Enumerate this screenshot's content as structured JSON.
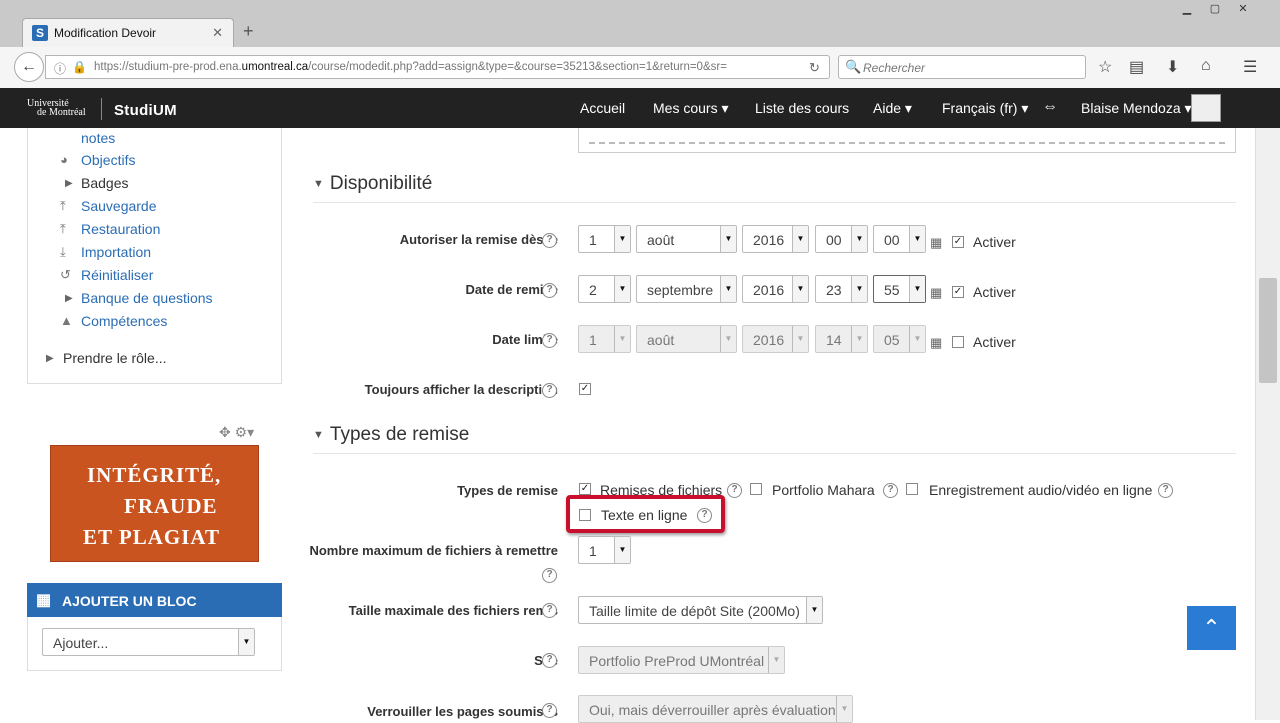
{
  "browser": {
    "tab_title": "Modification Devoir",
    "tab_favicon": "S",
    "url_prefix": "https://studium-pre-prod.ena.",
    "url_domain": "umontreal.ca",
    "url_path": "/course/modedit.php?add=assign&type=&course=35213&section=1&return=0&sr=",
    "search_placeholder": "Rechercher"
  },
  "moodle": {
    "logo_line1": "Université",
    "logo_line2": "de Montréal",
    "logo_name": "StudiUM",
    "nav": [
      "Accueil",
      "Mes cours ▾",
      "Liste des cours",
      "Aide ▾",
      "Français (fr) ▾"
    ],
    "user_name": "Blaise Mendoza ▾"
  },
  "sidebar": {
    "items": [
      {
        "label": "notes"
      },
      {
        "label": "Objectifs"
      },
      {
        "label": "Badges"
      },
      {
        "label": "Sauvegarde"
      },
      {
        "label": "Restauration"
      },
      {
        "label": "Importation"
      },
      {
        "label": "Réinitialiser"
      },
      {
        "label": "Banque de questions"
      },
      {
        "label": "Compétences"
      }
    ],
    "switch_role": "Prendre le rôle...",
    "banner_line1": "INTÉGRITÉ,",
    "banner_line2": "FRAUDE",
    "banner_line3": "ET PLAGIAT",
    "add_block_title": "AJOUTER UN BLOC",
    "add_block_select": "Ajouter..."
  },
  "availability": {
    "heading": "Disponibilité",
    "allow_from": {
      "label": "Autoriser la remise dès le",
      "day": "1",
      "month": "août",
      "year": "2016",
      "hour": "00",
      "minute": "00",
      "enable": "Activer"
    },
    "due_date": {
      "label": "Date de remise",
      "day": "2",
      "month": "septembre",
      "year": "2016",
      "hour": "23",
      "minute": "55",
      "enable": "Activer"
    },
    "cutoff": {
      "label": "Date limite",
      "day": "1",
      "month": "août",
      "year": "2016",
      "hour": "14",
      "minute": "05",
      "enable": "Activer"
    },
    "always_show": {
      "label": "Toujours afficher la description"
    }
  },
  "submission": {
    "heading": "Types de remise",
    "types_label": "Types de remise",
    "type_files": "Remises de fichiers",
    "type_mahara": "Portfolio Mahara",
    "type_av": "Enregistrement audio/vidéo en ligne",
    "type_online_text": "Texte en ligne",
    "max_files_label": "Nombre maximum de fichiers à remettre",
    "max_files_value": "1",
    "max_size_label": "Taille maximale des fichiers remis",
    "max_size_value": "Taille limite de dépôt Site (200Mo)",
    "site_label": "Site",
    "site_value": "Portfolio PreProd UMontréal",
    "lock_label": "Verrouiller les pages soumises",
    "lock_value": "Oui, mais déverrouiller après évaluation"
  },
  "colors": {
    "accent": "#2a6db5",
    "highlight": "#c8102e",
    "banner": "#c9541f"
  }
}
